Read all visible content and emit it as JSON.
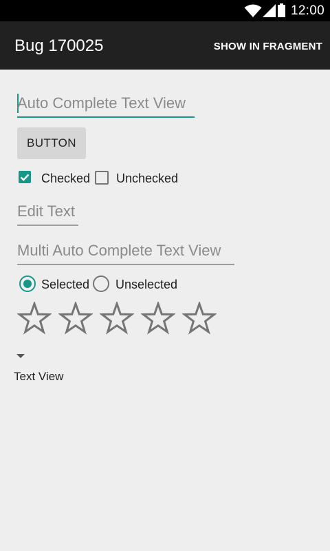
{
  "status_bar": {
    "time": "12:00",
    "icons": [
      "wifi-icon",
      "cell-signal-icon",
      "battery-icon"
    ]
  },
  "action_bar": {
    "title": "Bug 170025",
    "action_label": "SHOW IN FRAGMENT"
  },
  "form": {
    "auto_complete_hint": "Auto Complete Text View",
    "button_label": "BUTTON",
    "checkbox_checked_label": "Checked",
    "checkbox_unchecked_label": "Unchecked",
    "edit_text_hint": "Edit Text",
    "multi_auto_complete_hint": "Multi Auto Complete Text View",
    "radio_selected_label": "Selected",
    "radio_unselected_label": "Unselected",
    "rating": {
      "value": 0,
      "max": 5
    },
    "text_view": "Text View"
  },
  "colors": {
    "accent": "#16978a",
    "action_bar": "#212121",
    "background": "#eeeeee"
  }
}
